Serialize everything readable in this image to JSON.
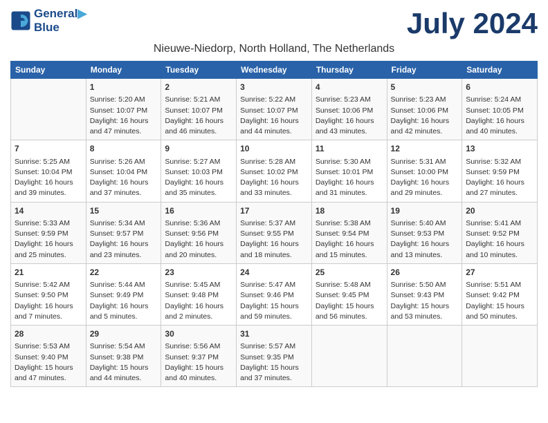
{
  "header": {
    "logo_line1": "General",
    "logo_line2": "Blue",
    "month_year": "July 2024",
    "location": "Nieuwe-Niedorp, North Holland, The Netherlands"
  },
  "weekdays": [
    "Sunday",
    "Monday",
    "Tuesday",
    "Wednesday",
    "Thursday",
    "Friday",
    "Saturday"
  ],
  "weeks": [
    [
      {
        "day": "",
        "info": ""
      },
      {
        "day": "1",
        "info": "Sunrise: 5:20 AM\nSunset: 10:07 PM\nDaylight: 16 hours\nand 47 minutes."
      },
      {
        "day": "2",
        "info": "Sunrise: 5:21 AM\nSunset: 10:07 PM\nDaylight: 16 hours\nand 46 minutes."
      },
      {
        "day": "3",
        "info": "Sunrise: 5:22 AM\nSunset: 10:07 PM\nDaylight: 16 hours\nand 44 minutes."
      },
      {
        "day": "4",
        "info": "Sunrise: 5:23 AM\nSunset: 10:06 PM\nDaylight: 16 hours\nand 43 minutes."
      },
      {
        "day": "5",
        "info": "Sunrise: 5:23 AM\nSunset: 10:06 PM\nDaylight: 16 hours\nand 42 minutes."
      },
      {
        "day": "6",
        "info": "Sunrise: 5:24 AM\nSunset: 10:05 PM\nDaylight: 16 hours\nand 40 minutes."
      }
    ],
    [
      {
        "day": "7",
        "info": "Sunrise: 5:25 AM\nSunset: 10:04 PM\nDaylight: 16 hours\nand 39 minutes."
      },
      {
        "day": "8",
        "info": "Sunrise: 5:26 AM\nSunset: 10:04 PM\nDaylight: 16 hours\nand 37 minutes."
      },
      {
        "day": "9",
        "info": "Sunrise: 5:27 AM\nSunset: 10:03 PM\nDaylight: 16 hours\nand 35 minutes."
      },
      {
        "day": "10",
        "info": "Sunrise: 5:28 AM\nSunset: 10:02 PM\nDaylight: 16 hours\nand 33 minutes."
      },
      {
        "day": "11",
        "info": "Sunrise: 5:30 AM\nSunset: 10:01 PM\nDaylight: 16 hours\nand 31 minutes."
      },
      {
        "day": "12",
        "info": "Sunrise: 5:31 AM\nSunset: 10:00 PM\nDaylight: 16 hours\nand 29 minutes."
      },
      {
        "day": "13",
        "info": "Sunrise: 5:32 AM\nSunset: 9:59 PM\nDaylight: 16 hours\nand 27 minutes."
      }
    ],
    [
      {
        "day": "14",
        "info": "Sunrise: 5:33 AM\nSunset: 9:59 PM\nDaylight: 16 hours\nand 25 minutes."
      },
      {
        "day": "15",
        "info": "Sunrise: 5:34 AM\nSunset: 9:57 PM\nDaylight: 16 hours\nand 23 minutes."
      },
      {
        "day": "16",
        "info": "Sunrise: 5:36 AM\nSunset: 9:56 PM\nDaylight: 16 hours\nand 20 minutes."
      },
      {
        "day": "17",
        "info": "Sunrise: 5:37 AM\nSunset: 9:55 PM\nDaylight: 16 hours\nand 18 minutes."
      },
      {
        "day": "18",
        "info": "Sunrise: 5:38 AM\nSunset: 9:54 PM\nDaylight: 16 hours\nand 15 minutes."
      },
      {
        "day": "19",
        "info": "Sunrise: 5:40 AM\nSunset: 9:53 PM\nDaylight: 16 hours\nand 13 minutes."
      },
      {
        "day": "20",
        "info": "Sunrise: 5:41 AM\nSunset: 9:52 PM\nDaylight: 16 hours\nand 10 minutes."
      }
    ],
    [
      {
        "day": "21",
        "info": "Sunrise: 5:42 AM\nSunset: 9:50 PM\nDaylight: 16 hours\nand 7 minutes."
      },
      {
        "day": "22",
        "info": "Sunrise: 5:44 AM\nSunset: 9:49 PM\nDaylight: 16 hours\nand 5 minutes."
      },
      {
        "day": "23",
        "info": "Sunrise: 5:45 AM\nSunset: 9:48 PM\nDaylight: 16 hours\nand 2 minutes."
      },
      {
        "day": "24",
        "info": "Sunrise: 5:47 AM\nSunset: 9:46 PM\nDaylight: 15 hours\nand 59 minutes."
      },
      {
        "day": "25",
        "info": "Sunrise: 5:48 AM\nSunset: 9:45 PM\nDaylight: 15 hours\nand 56 minutes."
      },
      {
        "day": "26",
        "info": "Sunrise: 5:50 AM\nSunset: 9:43 PM\nDaylight: 15 hours\nand 53 minutes."
      },
      {
        "day": "27",
        "info": "Sunrise: 5:51 AM\nSunset: 9:42 PM\nDaylight: 15 hours\nand 50 minutes."
      }
    ],
    [
      {
        "day": "28",
        "info": "Sunrise: 5:53 AM\nSunset: 9:40 PM\nDaylight: 15 hours\nand 47 minutes."
      },
      {
        "day": "29",
        "info": "Sunrise: 5:54 AM\nSunset: 9:38 PM\nDaylight: 15 hours\nand 44 minutes."
      },
      {
        "day": "30",
        "info": "Sunrise: 5:56 AM\nSunset: 9:37 PM\nDaylight: 15 hours\nand 40 minutes."
      },
      {
        "day": "31",
        "info": "Sunrise: 5:57 AM\nSunset: 9:35 PM\nDaylight: 15 hours\nand 37 minutes."
      },
      {
        "day": "",
        "info": ""
      },
      {
        "day": "",
        "info": ""
      },
      {
        "day": "",
        "info": ""
      }
    ]
  ]
}
